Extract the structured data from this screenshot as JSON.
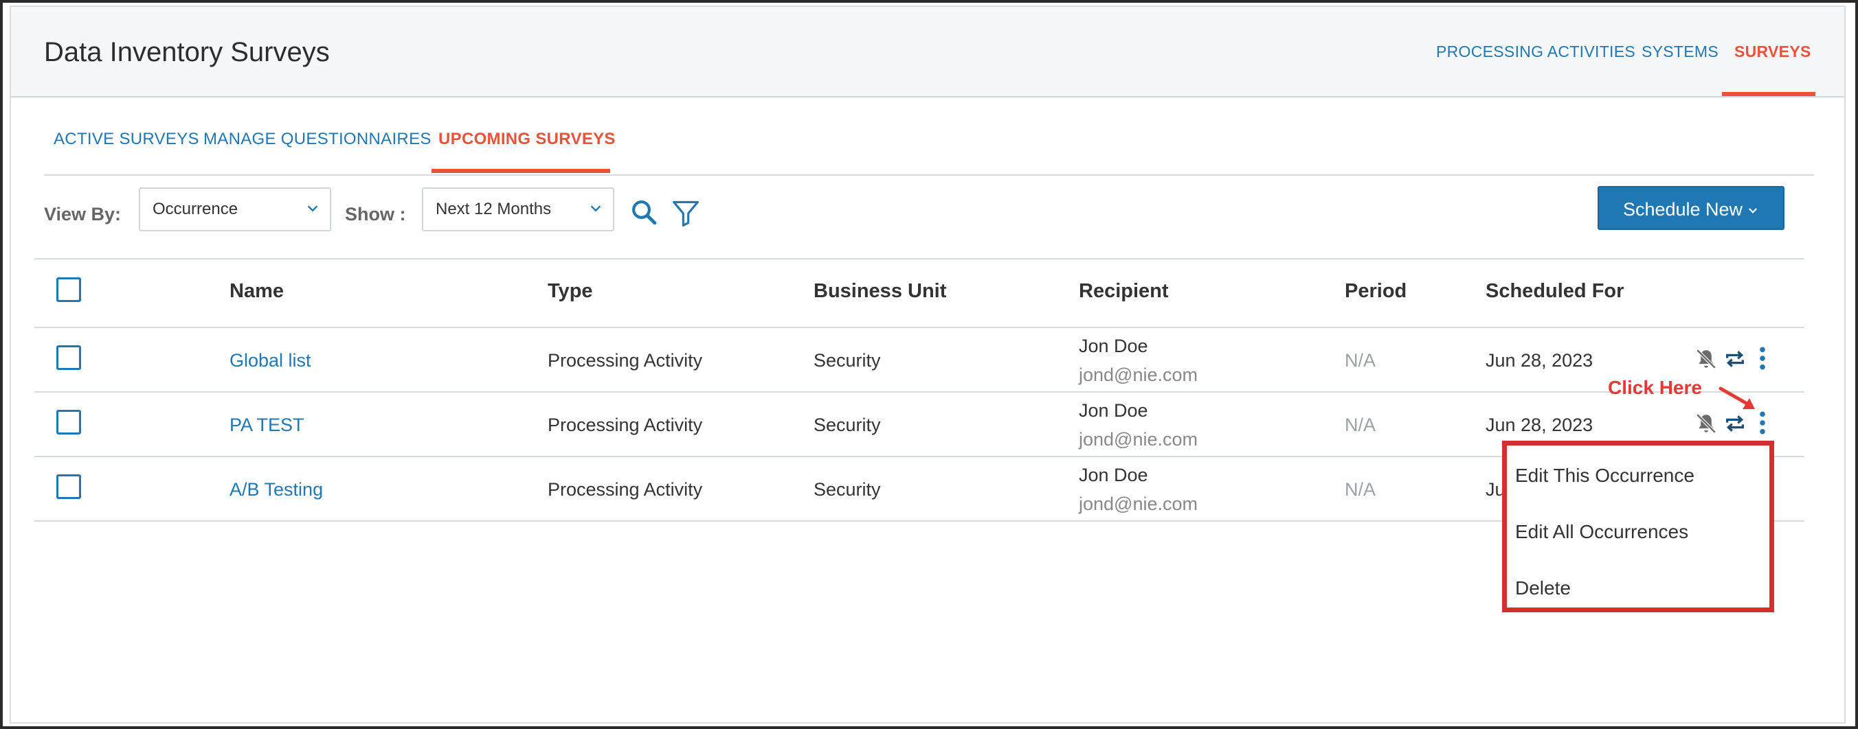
{
  "header": {
    "title": "Data Inventory Surveys",
    "nav": [
      {
        "label": "PROCESSING ACTIVITIES"
      },
      {
        "label": "SYSTEMS"
      },
      {
        "label": "SURVEYS",
        "active": true
      }
    ]
  },
  "subtabs": [
    {
      "label": "ACTIVE SURVEYS"
    },
    {
      "label": "MANAGE QUESTIONNAIRES"
    },
    {
      "label": "UPCOMING SURVEYS",
      "active": true
    }
  ],
  "toolbar": {
    "view_by_label": "View By:",
    "view_by_value": "Occurrence",
    "show_label": "Show :",
    "show_value": "Next 12 Months",
    "search_icon": "search-icon",
    "filter_icon": "filter-icon",
    "schedule_label": "Schedule New"
  },
  "table": {
    "columns": [
      "Name",
      "Type",
      "Business Unit",
      "Recipient",
      "Period",
      "Scheduled For"
    ],
    "rows": [
      {
        "name": "Global list",
        "type": "Processing Activity",
        "business_unit": "Security",
        "recipient_name": "Jon Doe",
        "recipient_email": "jond@nie.com",
        "period": "N/A",
        "scheduled_for": "Jun 28, 2023"
      },
      {
        "name": "PA TEST",
        "type": "Processing Activity",
        "business_unit": "Security",
        "recipient_name": "Jon Doe",
        "recipient_email": "jond@nie.com",
        "period": "N/A",
        "scheduled_for": "Jun 28, 2023"
      },
      {
        "name": "A/B Testing",
        "type": "Processing Activity",
        "business_unit": "Security",
        "recipient_name": "Jon Doe",
        "recipient_email": "jond@nie.com",
        "period": "N/A",
        "scheduled_for": "Ju"
      }
    ],
    "row_icons": [
      "bell-off-icon",
      "repeat-icon",
      "more-vertical-icon"
    ]
  },
  "menu": {
    "items": [
      {
        "label": "Edit This Occurrence"
      },
      {
        "label": "Edit All Occurrences"
      },
      {
        "label": "Delete"
      }
    ]
  },
  "annotation": {
    "text": "Click Here"
  },
  "colors": {
    "accent": "#1f77b4",
    "active": "#e8533a",
    "highlight": "#d32f2f"
  }
}
